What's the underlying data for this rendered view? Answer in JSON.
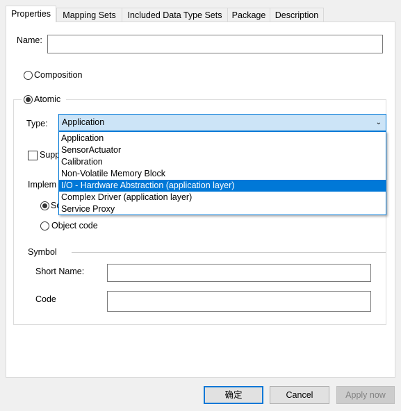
{
  "tabs": [
    "Properties",
    "Mapping Sets",
    "Included Data Type Sets",
    "Package",
    "Description"
  ],
  "name": {
    "label": "Name:",
    "value": ""
  },
  "composition_label": "Composition",
  "atomic_label": "Atomic",
  "type": {
    "label": "Type:",
    "selected": "Application",
    "options": [
      "Application",
      "SensorActuator",
      "Calibration",
      "Non-Volatile Memory Block",
      "I/O - Hardware Abstraction (application layer)",
      "Complex Driver (application layer)",
      "Service Proxy"
    ],
    "highlighted_index": 4
  },
  "supports_label_visible": "Supp",
  "implementation_label_visible": "Implem",
  "source_label_visible": "So",
  "object_code_label": "Object code",
  "symbol": {
    "title": "Symbol",
    "short_name_label": "Short Name:",
    "short_name_value": "",
    "code_label": "Code",
    "code_value": ""
  },
  "buttons": {
    "ok": "确定",
    "cancel": "Cancel",
    "apply": "Apply now"
  }
}
